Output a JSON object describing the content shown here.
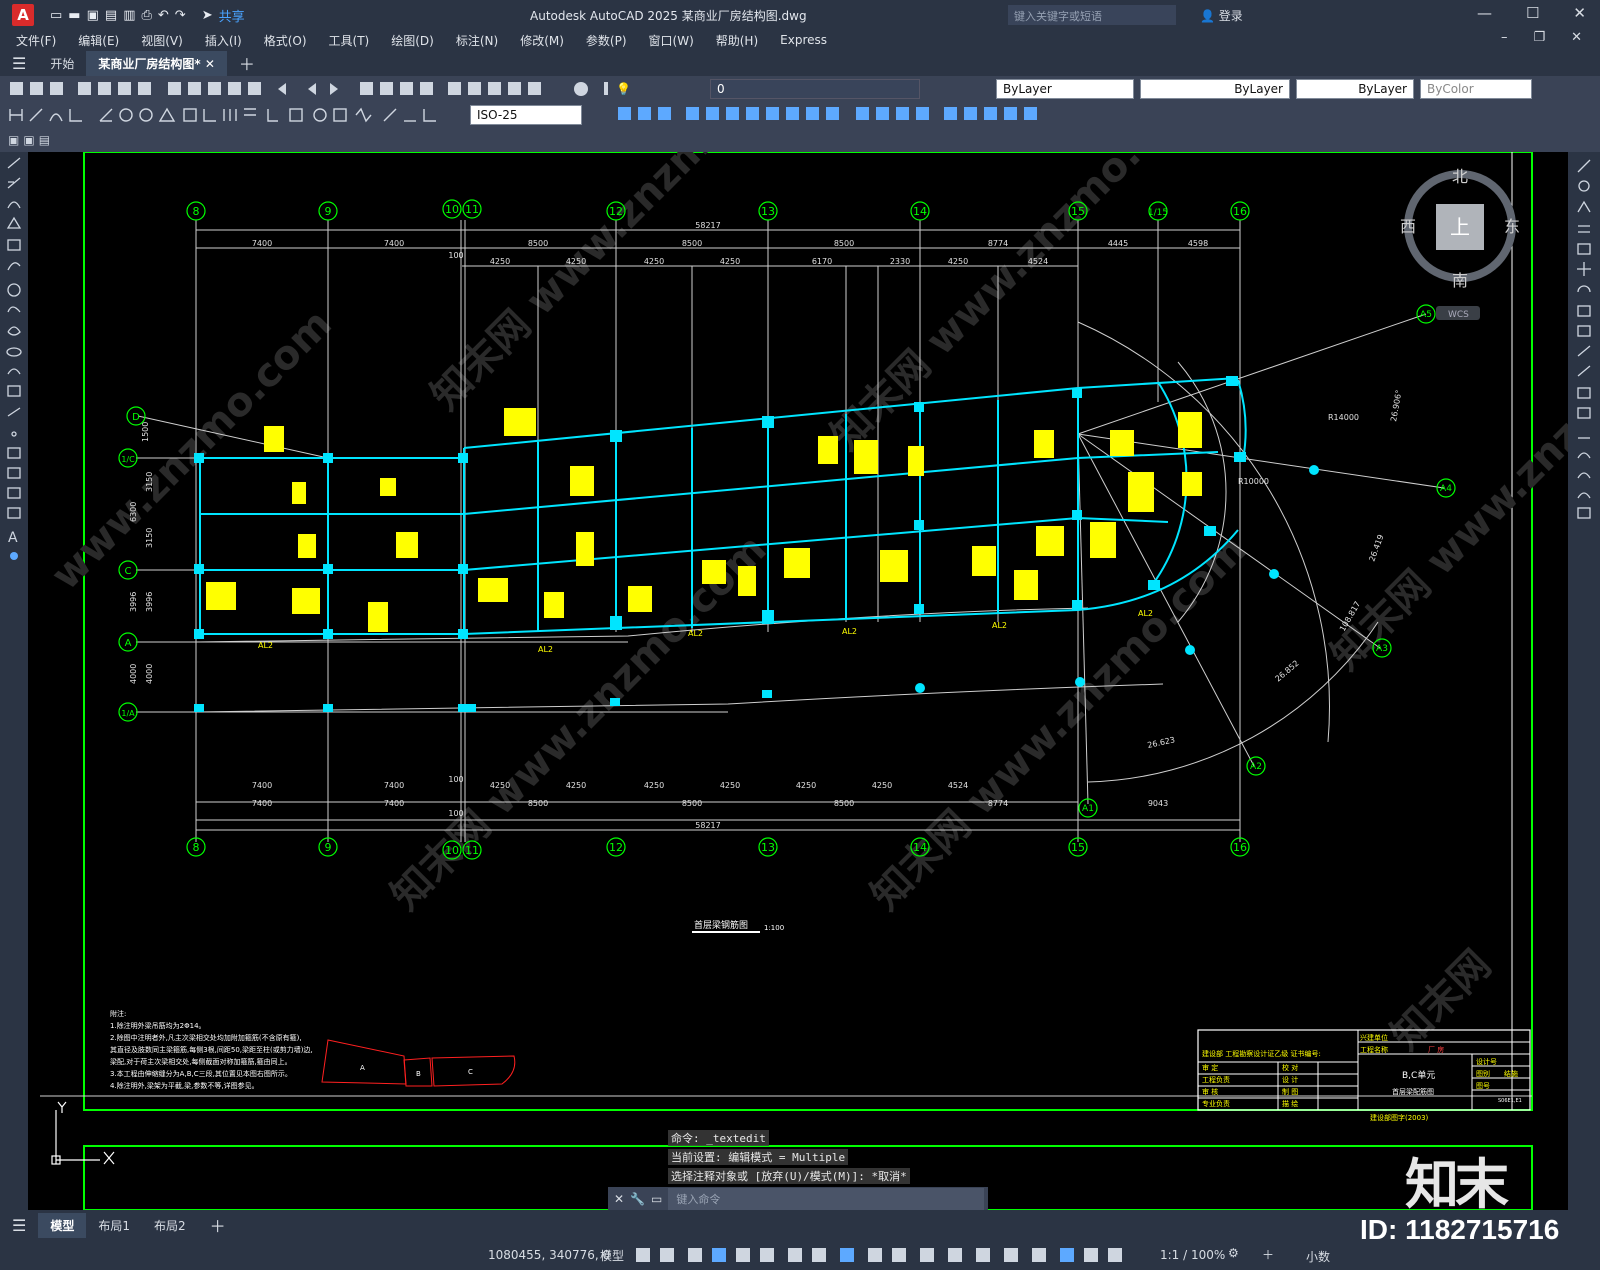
{
  "app": {
    "logo": "A",
    "title": "Autodesk AutoCAD 2025    某商业厂房结构图.dwg",
    "share": "共享",
    "search_placeholder": "键入关键字或短语",
    "login": "登录"
  },
  "menu": [
    "文件(F)",
    "编辑(E)",
    "视图(V)",
    "插入(I)",
    "格式(O)",
    "工具(T)",
    "绘图(D)",
    "标注(N)",
    "修改(M)",
    "参数(P)",
    "窗口(W)",
    "帮助(H)",
    "Express"
  ],
  "tabs": [
    "开始",
    "某商业厂房结构图*"
  ],
  "toolbar": {
    "layer": "0",
    "color": "ByLayer",
    "linetype": "ByLayer",
    "lineweight": "ByLayer",
    "plotstyle": "ByColor",
    "dimstyle": "ISO-25"
  },
  "viewcube": {
    "north": "北",
    "south": "南",
    "east": "东",
    "west": "西",
    "top": "上",
    "wcs": "WCS"
  },
  "drawing": {
    "top_total": "58217",
    "bottom_total": "58217",
    "grid_top": [
      "8",
      "9",
      "10",
      "11",
      "12",
      "13",
      "14",
      "15",
      "1/15",
      "16"
    ],
    "grid_bottom": [
      "8",
      "9",
      "10",
      "11",
      "12",
      "13",
      "14",
      "15",
      "16"
    ],
    "dims_top_row1": [
      "7400",
      "7400",
      "8500",
      "8500",
      "8500",
      "8774",
      "4445",
      "4598"
    ],
    "dims_top_row2": [
      "4250",
      "4250",
      "4250",
      "4250",
      "6170",
      "2330",
      "4250",
      "4524"
    ],
    "dims_bottom_row1": [
      "7400",
      "7400",
      "4250",
      "4250",
      "4250",
      "4250",
      "4250",
      "4250",
      "4524"
    ],
    "dims_bottom_row2": [
      "7400",
      "7400",
      "8500",
      "8500",
      "8500",
      "8774",
      "9043"
    ],
    "left_axes": [
      "D",
      "1/C",
      "C",
      "A",
      "1/A"
    ],
    "left_dims": [
      "1500",
      "3150",
      "6300",
      "3150",
      "3996",
      "3996",
      "4000",
      "4000"
    ],
    "radial_axes": [
      "A5",
      "A4",
      "A3",
      "A2",
      "A1"
    ],
    "radii": [
      "R14000",
      "R10000"
    ],
    "arc_dims": [
      "26.906°",
      "26.419",
      "108.817",
      "26.852",
      "26.623"
    ],
    "small_100": "100",
    "beam_label": "AL2",
    "drawing_title": "首层梁钢筋图",
    "scale": "1:100",
    "notes_title": "附注:",
    "notes": [
      "1.除注明外梁吊筋均为2Φ14。",
      "2.除图中注明者外,凡主次梁相交处均加附加箍筋(不含原有箍),",
      "   其直径及肢数同主梁箍筋,每侧3根,间距50,梁距至柱(或剪力墙)边,",
      "   梁配,对于荷主次梁相交处,每侧截面对称加箍筋,箍由同上。",
      "3.本工程由伸缩缝分为A,B,C三段,其位置见本图右图所示。",
      "4.除注明外,梁架为平截,梁,参数不等,详图参见。"
    ],
    "key_plan": [
      "A",
      "B",
      "C"
    ],
    "title_block": {
      "unit": "兴建单位",
      "project": "工程名称",
      "project_value": "厂   房",
      "part": "B,C单元",
      "sheet": "首层梁配筋图",
      "design_no": "设计号",
      "sheet_no": "图别",
      "struct": "结施",
      "sheet_num": "图号",
      "page": "S06E1,E1",
      "rows": [
        "审 定",
        "工程负责",
        "审 核",
        "专业负责"
      ],
      "cols": [
        "校 对",
        "设 计",
        "制 图",
        "描 绘"
      ],
      "cert": "建设部 工程勘察设计证乙级 证书编号:",
      "footer": "建设部图字(2003)"
    }
  },
  "command": {
    "line1": "命令: _textedit",
    "line2": "当前设置: 编辑模式 = Multiple",
    "line3": "选择注释对象或 [放弃(U)/模式(M)]: *取消*",
    "input_placeholder": "键入命令"
  },
  "layouts": [
    "模型",
    "布局1",
    "布局2"
  ],
  "status": {
    "coords": "1080455, 340776, 0",
    "model": "模型",
    "scale": "1:1 / 100%",
    "units": "小数"
  },
  "watermark": {
    "logo": "知末",
    "id": "ID: 1182715716"
  },
  "colors": {
    "canvas": "#000000",
    "frame": "#00ff00",
    "beam": "#00e5ff",
    "text": "#ffff00",
    "grid": "#cfcfcf",
    "accent": "#d92b2b"
  }
}
